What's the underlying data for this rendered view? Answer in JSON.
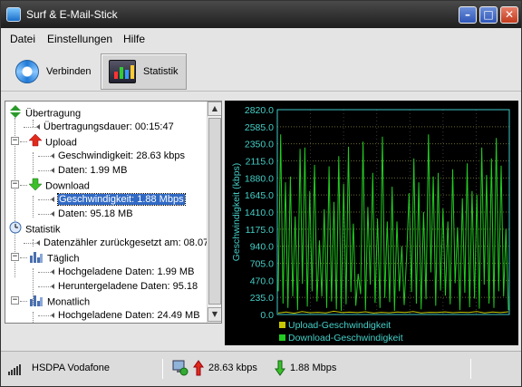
{
  "window": {
    "title": "Surf & E-Mail-Stick"
  },
  "menu": {
    "items": [
      "Datei",
      "Einstellungen",
      "Hilfe"
    ]
  },
  "toolbar": {
    "connect_label": "Verbinden",
    "stats_label": "Statistik"
  },
  "tree": {
    "rows": [
      {
        "text": "Übertragung",
        "icon": "transfer-icon"
      },
      {
        "text": "Übertragungsdauer: 00:15:47"
      },
      {
        "text": "Upload",
        "icon": "upload-arrow-icon"
      },
      {
        "text": "Geschwindigkeit: 28.63 kbps"
      },
      {
        "text": "Daten: 1.99 MB"
      },
      {
        "text": "Download",
        "icon": "download-arrow-icon"
      },
      {
        "text": "Geschwindigkeit: 1.88 Mbps",
        "selected": true
      },
      {
        "text": "Daten: 95.18 MB"
      },
      {
        "text": "Statistik",
        "icon": "clock-icon"
      },
      {
        "text": "Datenzähler zurückgesetzt am: 08.07"
      },
      {
        "text": "Täglich",
        "icon": "bar-chart-icon"
      },
      {
        "text": "Hochgeladene Daten: 1.99 MB"
      },
      {
        "text": "Heruntergeladene Daten: 95.18"
      },
      {
        "text": "Monatlich",
        "icon": "bar-chart-icon"
      },
      {
        "text": "Hochgeladene Daten: 24.49 MB"
      }
    ]
  },
  "chart_data": {
    "type": "line",
    "title": "",
    "xlabel": "",
    "ylabel": "Geschwindigkeit (kbps)",
    "ylim": [
      0,
      2820
    ],
    "yticks": [
      "2820.0",
      "2585.0",
      "2350.0",
      "2115.0",
      "1880.0",
      "1645.0",
      "1410.0",
      "1175.0",
      "940.0",
      "705.0",
      "470.0",
      "235.0",
      "0.0"
    ],
    "grid": true,
    "legend": "bottom-left",
    "colors": {
      "upload": "#c8c800",
      "download": "#22cc22",
      "axis": "#3fc8c8",
      "text": "#44d0c8",
      "background": "#000000"
    },
    "series": [
      {
        "name": "Upload-Geschwindigkeit",
        "values": [
          20,
          35,
          18,
          40,
          25,
          30,
          22,
          45,
          28,
          33,
          26,
          38,
          20,
          30,
          24,
          35,
          29,
          41,
          22,
          30,
          27,
          36,
          25,
          31,
          28,
          40,
          22,
          34,
          26,
          38
        ]
      },
      {
        "name": "Download-Geschwindigkeit",
        "values": [
          320,
          2480,
          150,
          1820,
          90,
          1900,
          250,
          1350,
          60,
          2280,
          420,
          2300,
          110,
          1700,
          320,
          2060,
          180,
          1020,
          250,
          1450,
          90,
          2040,
          180,
          1550,
          70,
          2180,
          50,
          1800,
          140,
          2310,
          310,
          1250,
          120,
          560,
          280,
          2380,
          60,
          1480,
          410,
          1950,
          160,
          1320,
          90,
          2450,
          230,
          1280,
          170,
          1760,
          50,
          1280,
          320,
          940,
          130,
          800,
          1670,
          310,
          2150,
          150,
          1820,
          70,
          1410,
          210,
          2480,
          580,
          1900,
          120,
          1950,
          330,
          1460,
          260,
          1280,
          140,
          2000,
          430,
          1200,
          60,
          1600,
          300,
          2080,
          100,
          1700,
          220,
          1650,
          80,
          2300,
          410,
          1920,
          150,
          2150,
          90,
          2430,
          320,
          2050,
          250,
          1180,
          60
        ]
      }
    ]
  },
  "status": {
    "network": "HSDPA  Vodafone",
    "upload_speed": "28.63 kbps",
    "download_speed": "1.88 Mbps"
  }
}
